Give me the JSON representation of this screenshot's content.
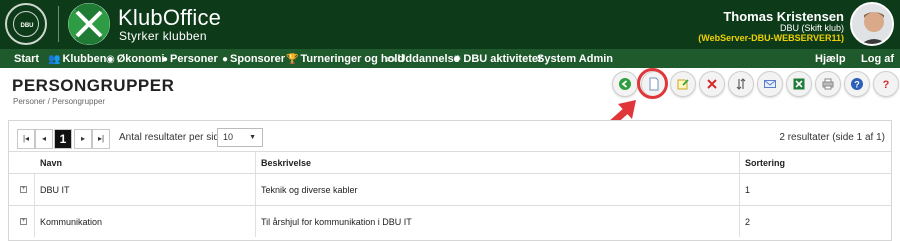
{
  "header": {
    "seal_text": "DBU",
    "app_title": "KlubOffice",
    "app_subtitle": "Styrker klubben",
    "user_name": "Thomas Kristensen",
    "user_club": "DBU (Skift klub)",
    "user_server": "(WebServer-DBU-WEBSERVER11)"
  },
  "nav": {
    "items": [
      {
        "label": "Start",
        "icon": ""
      },
      {
        "label": "Klubben",
        "icon": "people-icon"
      },
      {
        "label": "Økonomi",
        "icon": "coin-icon"
      },
      {
        "label": "Personer",
        "icon": "person-icon"
      },
      {
        "label": "Sponsorer",
        "icon": "person-icon"
      },
      {
        "label": "Turneringer og hold",
        "icon": "trophy-icon"
      },
      {
        "label": "Uddannelse",
        "icon": "screen-icon"
      },
      {
        "label": "DBU aktiviteter",
        "icon": "gear-icon"
      },
      {
        "label": "System Admin",
        "icon": ""
      }
    ],
    "right_items": [
      {
        "label": "Hjælp"
      },
      {
        "label": "Log af"
      }
    ]
  },
  "page": {
    "title": "PERSONGRUPPER",
    "breadcrumb": "Personer / Persongrupper"
  },
  "toolbar": {
    "buttons": [
      {
        "name": "back-icon"
      },
      {
        "name": "new-document-icon"
      },
      {
        "name": "edit-icon"
      },
      {
        "name": "delete-icon"
      },
      {
        "name": "sort-icon"
      },
      {
        "name": "email-icon"
      },
      {
        "name": "excel-icon"
      },
      {
        "name": "print-icon"
      },
      {
        "name": "help-icon"
      },
      {
        "name": "question-icon"
      }
    ]
  },
  "pager": {
    "first": "|◂",
    "prev": "◂",
    "current": "1",
    "next": "▸",
    "last": "▸|",
    "per_page_label": "Antal resultater per side",
    "per_page_value": "10",
    "result_count": "2 resultater (side 1 af 1)"
  },
  "table": {
    "columns": [
      "Navn",
      "Beskrivelse",
      "Sortering"
    ],
    "rows": [
      {
        "navn": "DBU IT",
        "beskrivelse": "Teknik og diverse kabler",
        "sortering": "1"
      },
      {
        "navn": "Kommunikation",
        "beskrivelse": "Til årshjul for kommunikation i DBU IT",
        "sortering": "2"
      }
    ]
  },
  "colors": {
    "header_bg": "#0d3b1a",
    "nav_bg": "#1f5a2c",
    "server_text": "#f0d000",
    "highlight": "#e0363a"
  }
}
